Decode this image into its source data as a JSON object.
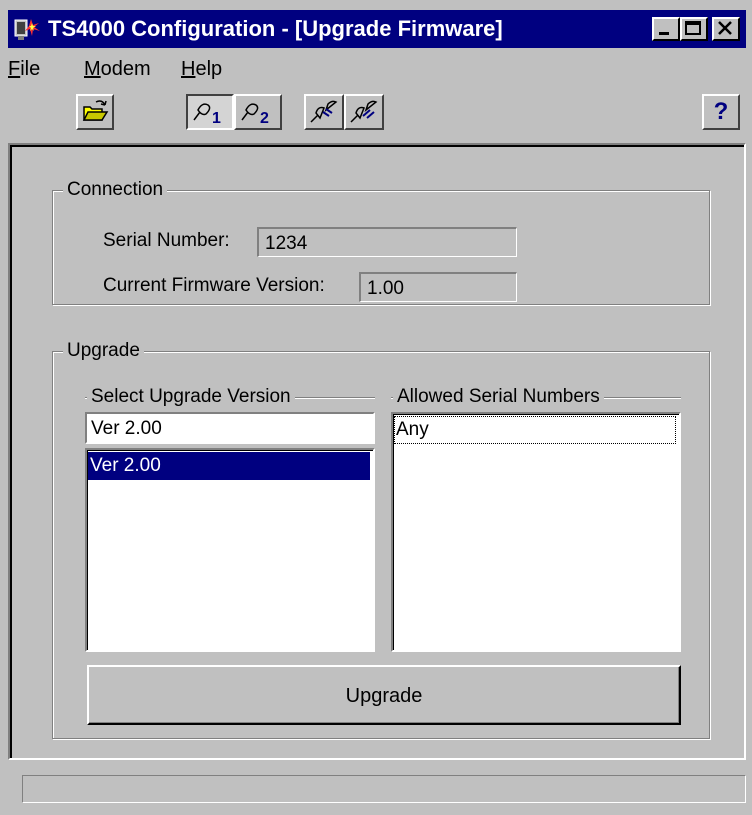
{
  "window": {
    "title": "TS4000 Configuration - [Upgrade Firmware]",
    "app_icon": "ts4000-app-icon",
    "title_buttons": [
      "minimize-icon",
      "maximize-icon",
      "close-icon"
    ]
  },
  "menu": {
    "items": [
      {
        "label": "File",
        "mnemonic": "F"
      },
      {
        "label": "Modem",
        "mnemonic": "M"
      },
      {
        "label": "Help",
        "mnemonic": "H"
      }
    ]
  },
  "toolbar": {
    "open_icon": "open-folder-icon",
    "probe1_icon": "probe-1-icon",
    "probe2_icon": "probe-2-icon",
    "probe1_label": "1",
    "probe2_label": "2",
    "connect_icon": "connect-icon",
    "disconnect_icon": "disconnect-icon",
    "help_label": "?"
  },
  "connection": {
    "group_label": "Connection",
    "serial_label": "Serial Number:",
    "serial_value": "1234",
    "firmware_label": "Current Firmware Version:",
    "firmware_value": "1.00"
  },
  "upgrade": {
    "group_label": "Upgrade",
    "select_label": "Select Upgrade Version",
    "select_value": "Ver 2.00",
    "versions": [
      "Ver 2.00"
    ],
    "allowed_label": "Allowed Serial Numbers",
    "allowed": [
      "Any"
    ],
    "button_label": "Upgrade"
  },
  "colors": {
    "titlebar": "#000080",
    "face": "#c0c0c0",
    "selection": "#000080"
  }
}
